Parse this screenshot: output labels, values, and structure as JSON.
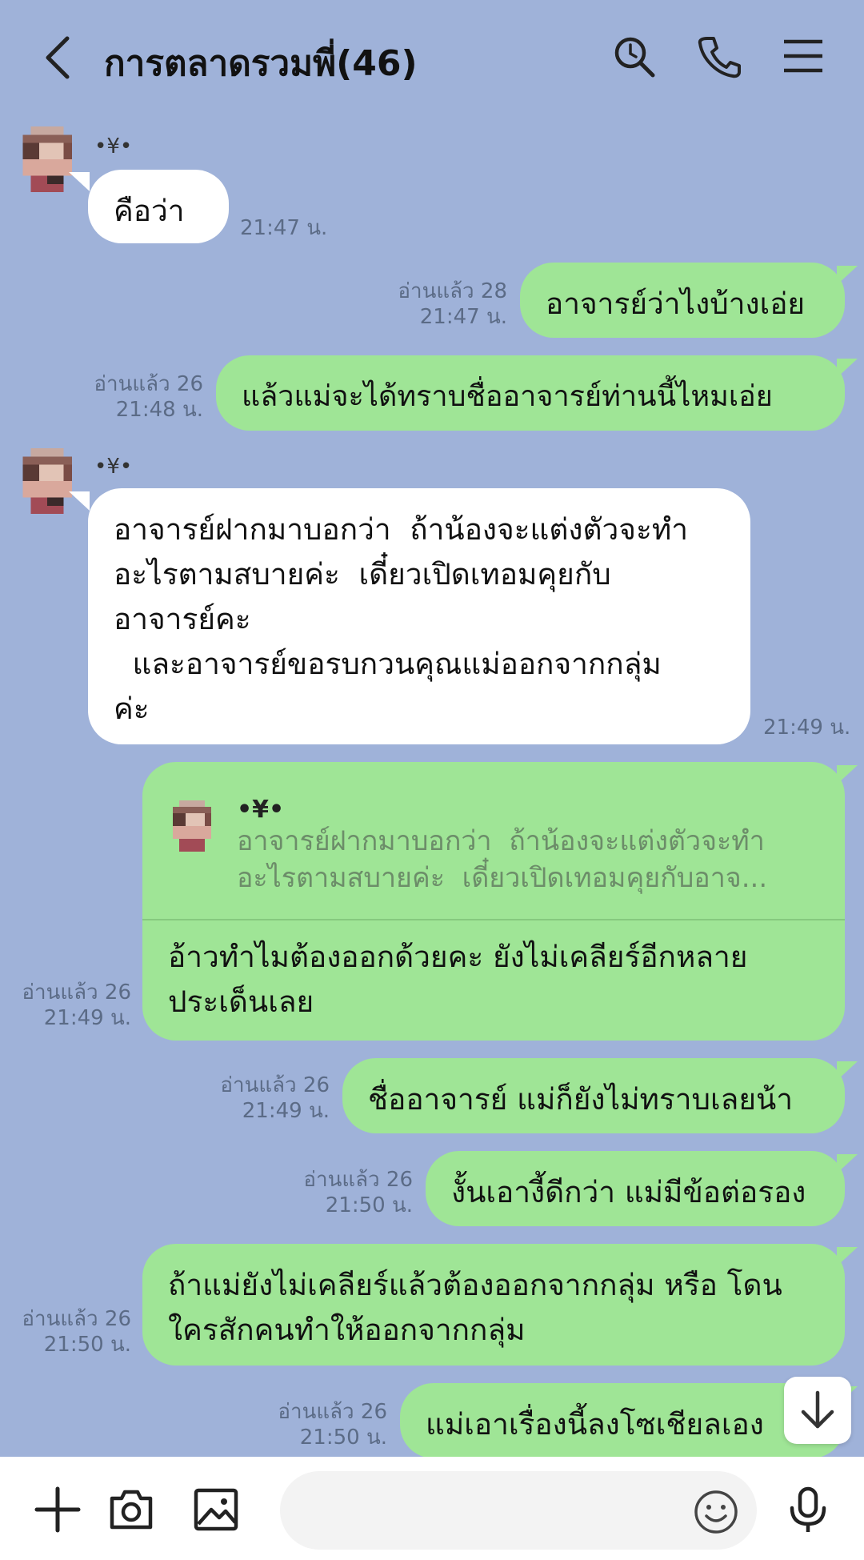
{
  "header": {
    "title": "การตลาดรวมพี่(46)"
  },
  "messages": {
    "m1": {
      "sender": "•¥•",
      "text": "คือว่า",
      "time": "21:47 น."
    },
    "m2": {
      "read": "อ่านแล้ว 28",
      "time": "21:47 น.",
      "text": "อาจารย์ว่าไงบ้างเอ่ย"
    },
    "m3": {
      "read": "อ่านแล้ว 26",
      "time": "21:48 น.",
      "text": "แล้วแม่จะได้ทราบชื่ออาจารย์ท่านนี้ไหมเอ่ย"
    },
    "m4": {
      "sender": "•¥•",
      "text": "อาจารย์ฝากมาบอกว่า  ถ้าน้องจะแต่งตัวจะทำ\nอะไรตามสบายค่ะ  เดี๋ยวเปิดเทอมคุยกับ\nอาจารย์คะ\n  และอาจารย์ขอรบกวนคุณแม่ออกจากกลุ่ม\nค่ะ",
      "time": "21:49 น."
    },
    "m5": {
      "read": "อ่านแล้ว 26",
      "time": "21:49 น.",
      "quote_name": "•¥•",
      "quote_text": "อาจารย์ฝากมาบอกว่า  ถ้าน้องจะแต่งตัวจะทำ\nอะไรตามสบายค่ะ  เดี๋ยวเปิดเทอมคุยกับอาจ...",
      "text": "อ้าวทำไมต้องออกด้วยคะ ยังไม่เคลียร์อีกหลาย\nประเด็นเลย"
    },
    "m6": {
      "read": "อ่านแล้ว 26",
      "time": "21:49 น.",
      "text": "ชื่ออาจารย์ แม่ก็ยังไม่ทราบเลยน้า"
    },
    "m7": {
      "read": "อ่านแล้ว 26",
      "time": "21:50 น.",
      "text": "งั้นเอางี้ดีกว่า แม่มีข้อต่อรอง"
    },
    "m8": {
      "read": "อ่านแล้ว 26",
      "time": "21:50 น.",
      "text": "ถ้าแม่ยังไม่เคลียร์แล้วต้องออกจากกลุ่ม หรือ โดน\nใครสักคนทำให้ออกจากกลุ่ม"
    },
    "m9": {
      "read": "อ่านแล้ว 26",
      "time": "21:50 น.",
      "text": "แม่เอาเรื่องนี้ลงโซเชียลเอง"
    }
  },
  "composer": {
    "placeholder": ""
  },
  "colors": {
    "background": "#9fb2d9",
    "outgoing": "#9fe596",
    "incoming": "#ffffff"
  },
  "icons": [
    "back-icon",
    "search-icon",
    "phone-icon",
    "menu-icon",
    "plus-icon",
    "camera-icon",
    "image-icon",
    "emoji-icon",
    "mic-icon",
    "arrow-down-icon"
  ]
}
